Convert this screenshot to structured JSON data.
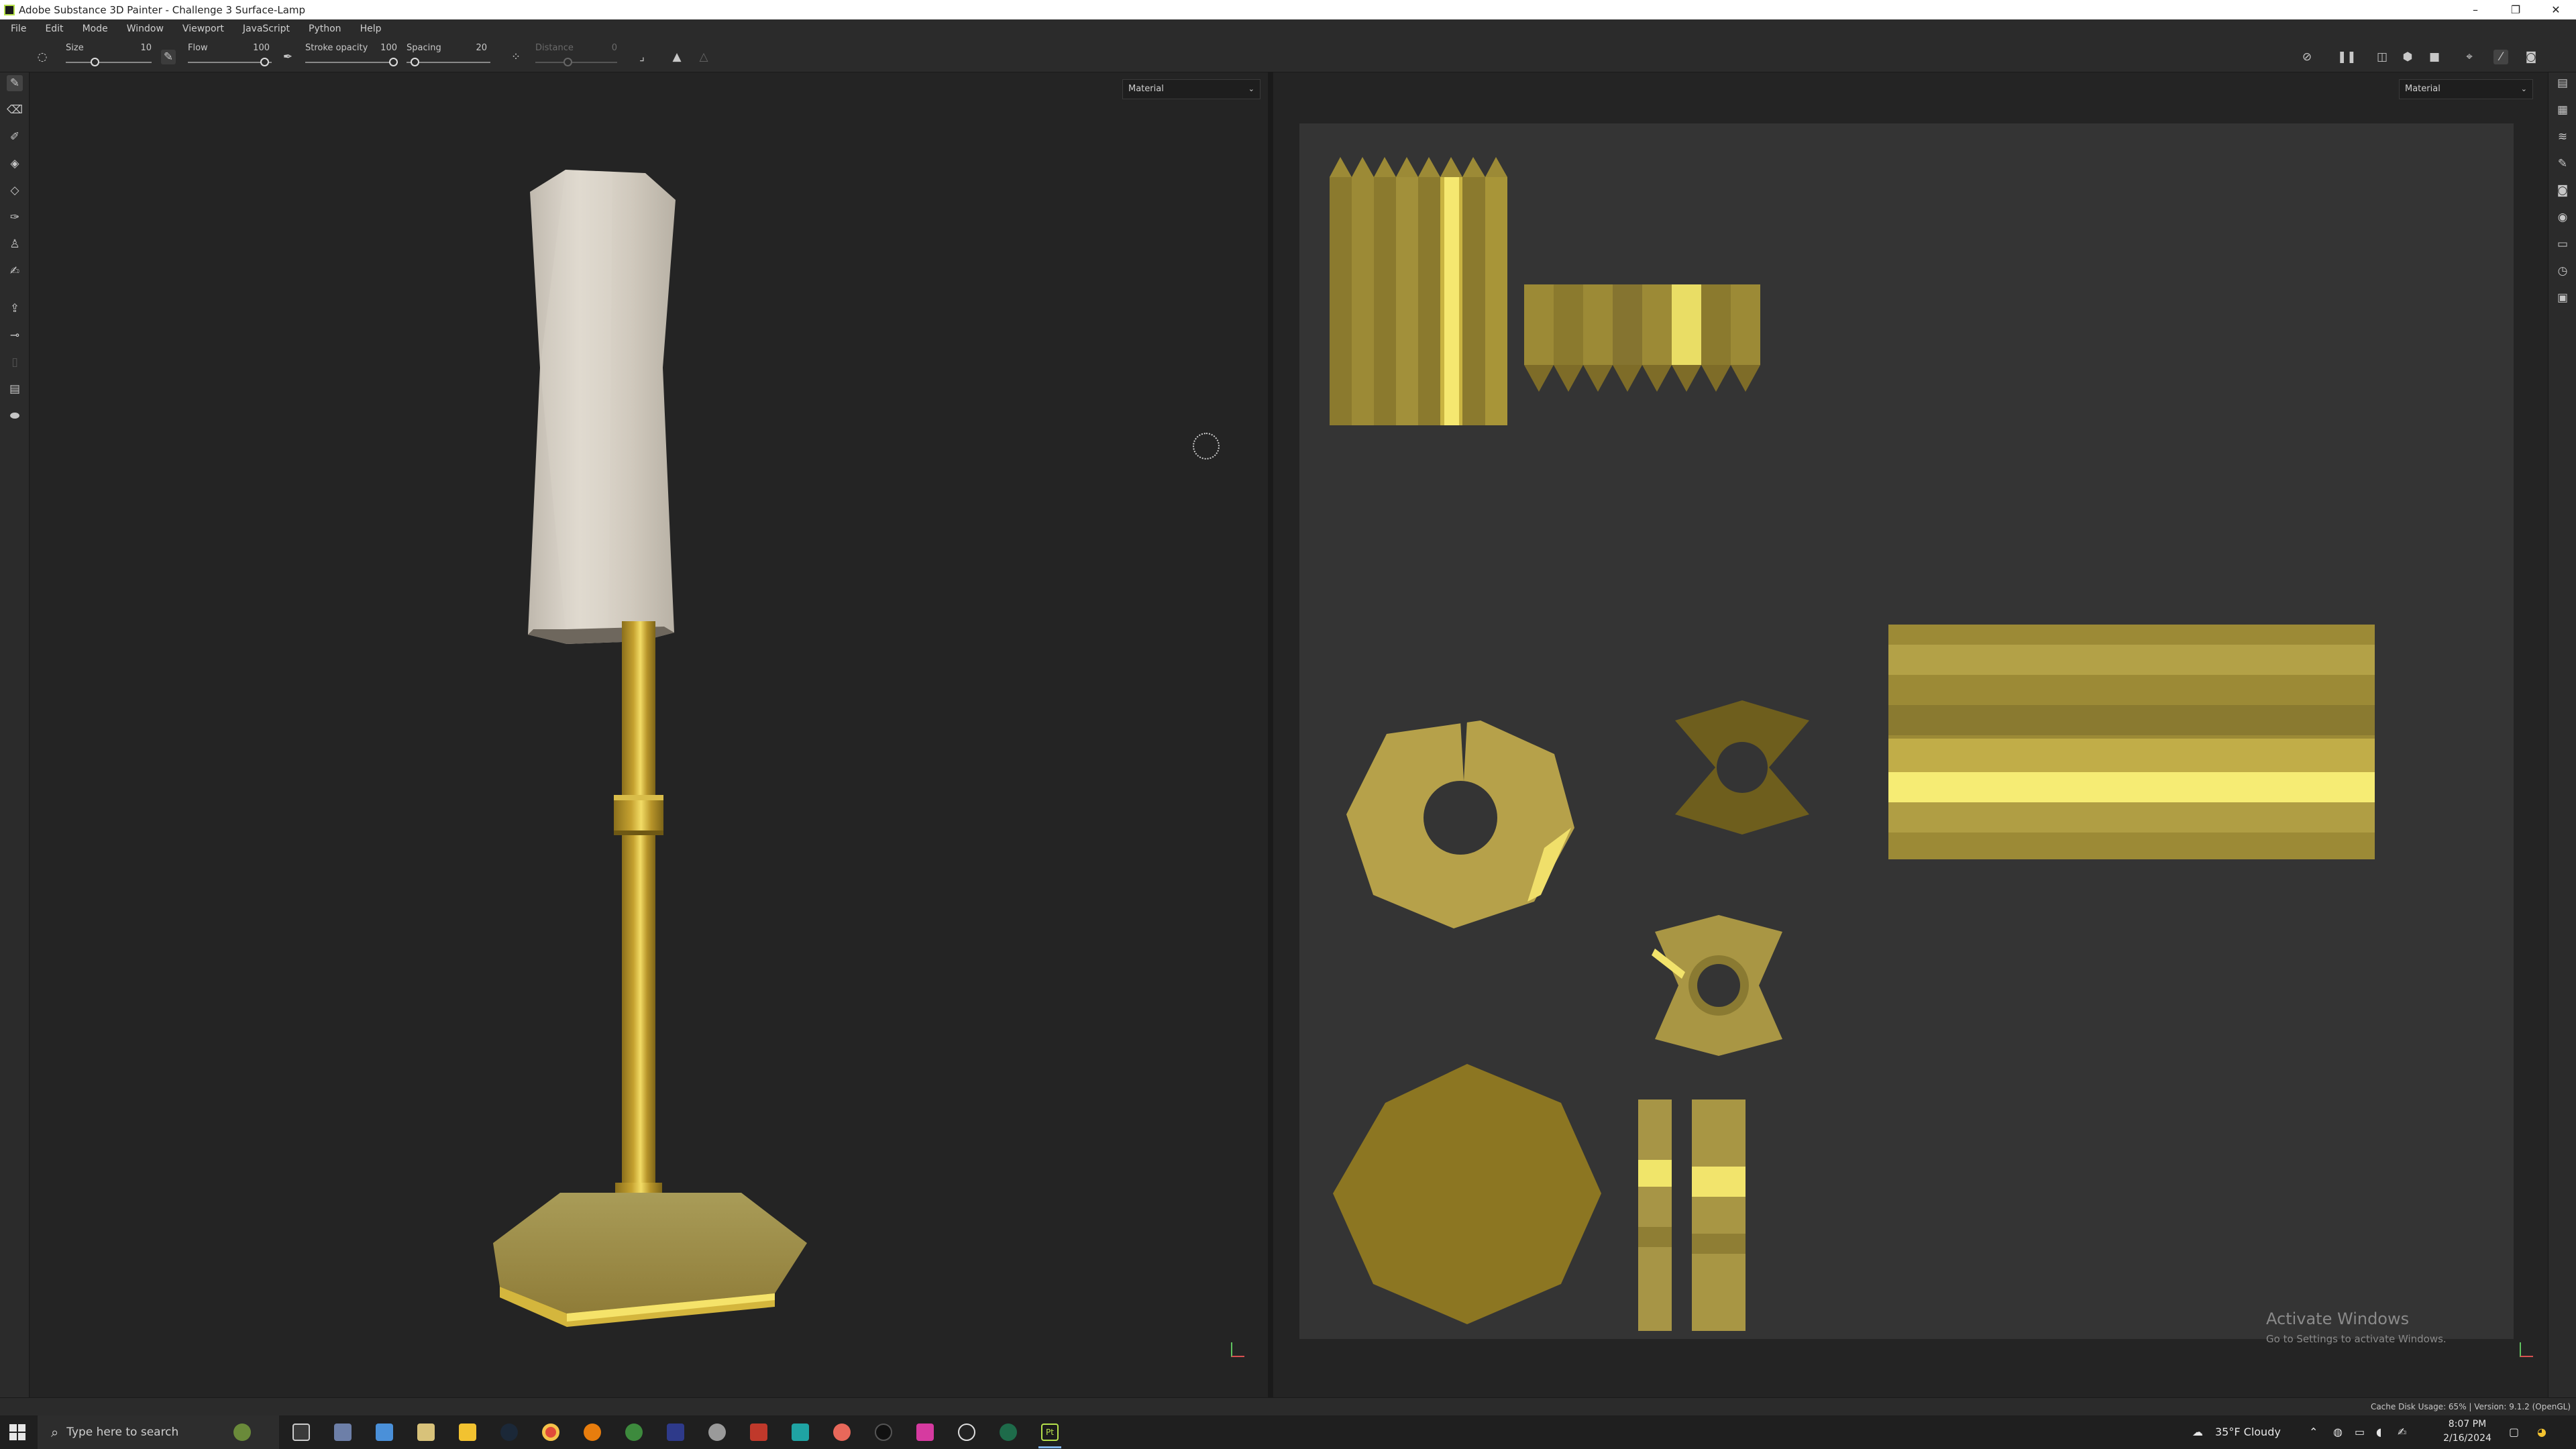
{
  "window": {
    "title": "Adobe Substance 3D Painter - Challenge 3 Surface-Lamp",
    "minimize": "–",
    "restore": "❐",
    "close": "✕"
  },
  "menu": [
    "File",
    "Edit",
    "Mode",
    "Window",
    "Viewport",
    "JavaScript",
    "Python",
    "Help"
  ],
  "toolbar": {
    "size_label": "Size",
    "size_value": "10",
    "flow_label": "Flow",
    "flow_value": "100",
    "stroke_opacity_label": "Stroke opacity",
    "stroke_opacity_value": "100",
    "spacing_label": "Spacing",
    "spacing_value": "20",
    "distance_label": "Distance",
    "distance_value": "0"
  },
  "viewport3d": {
    "dropdown": "Material"
  },
  "viewport2d": {
    "dropdown": "Material"
  },
  "watermark": {
    "line1": "Activate Windows",
    "line2": "Go to Settings to activate Windows."
  },
  "status": {
    "text": "Cache Disk Usage:  65% | Version: 9.1.2 (OpenGL)"
  },
  "taskbar": {
    "search_placeholder": "Type here to search",
    "weather": "35°F  Cloudy",
    "time": "8:07 PM",
    "date": "2/16/2024"
  },
  "colors": {
    "accent": "#b7e24c",
    "gold": "#c9a93a",
    "panel": "#2b2b2b",
    "viewport": "#242424",
    "uv_bg": "#343434"
  }
}
